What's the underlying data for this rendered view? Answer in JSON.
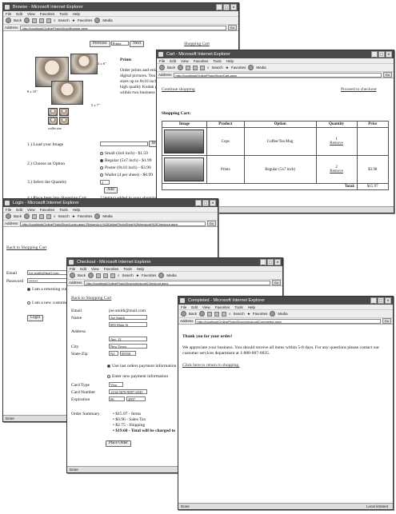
{
  "menu": [
    "File",
    "Edit",
    "View",
    "Favorites",
    "Tools",
    "Help"
  ],
  "toolbar": {
    "back": "Back",
    "search": "Search",
    "favorites": "Favorites",
    "media": "Media",
    "address_label": "Address",
    "go": "Go",
    "links": "Links"
  },
  "status": {
    "done": "Done",
    "zone": "Local intranet"
  },
  "browse": {
    "title": "Browse - Microsoft Internet Explorer",
    "address": "http://localhost/OnlinePhotoShop/Browse.aspx",
    "nav": {
      "previous": "Previous",
      "select_value": "Prints",
      "next": "Next",
      "shopping_cart": "Shopping Cart"
    },
    "sizes": {
      "s4x6": "4 x 6\"",
      "s8x10": "8 x 10\"",
      "s5x7": "5 x 7\"",
      "wallet": "wallet size"
    },
    "prints_title": "Prints",
    "desc": [
      "Order prints and enlarge",
      "digital pictures. You ca",
      "sizes up to 8x10 inch",
      "high quality Kodak pho",
      "within two business da"
    ],
    "steps": {
      "s1": "1.) Load your Image",
      "browse_btn": "Browse",
      "s2": "2.) Choose an Option",
      "s3": "3.) Select the Quantity",
      "qty": "2",
      "add_btn": "Add",
      "s4": "4.) Place Item into Shopping Cart",
      "added": "2 item(s) added to your shopping"
    },
    "options": [
      "Small (4x6 inch) - $1.59",
      "Regular (5x7 inch) - $1.99",
      "Poster (8x10 inch) - $3.99",
      "Wallet (4 per sheet) - $0.99"
    ]
  },
  "cart": {
    "title": "Cart - Microsoft Internet Explorer",
    "address": "http://localhost/OnlinePhotoShop/Cart.aspx",
    "continue": "Continue shopping",
    "checkout": "Proceed to checkout",
    "heading": "Shopping Cart:",
    "headers": [
      "Image",
      "Product",
      "Option",
      "Quantity",
      "Price"
    ],
    "rows": [
      {
        "product": "Cups",
        "option": "Coffee/Tea Mug",
        "qty": "1",
        "remove": "Remove",
        "price": ""
      },
      {
        "product": "Prints",
        "option": "Regular (5x7 inch)",
        "qty": "2",
        "remove": "Remove",
        "price": "$3.98"
      }
    ],
    "total_label": "Total:",
    "total": "$15.97"
  },
  "login": {
    "title": "Login - Microsoft Internet Explorer",
    "address": "http://localhost/OnlinePhotoShop/Login.aspx?ReturnUrl=%2fOnlinePhotoShop%2fcheckout%2fCheckout.aspx",
    "back": "Back to Shopping Cart",
    "email_label": "Email",
    "email": "joe.smith@mail.com",
    "password_label": "Password",
    "password": "•••••••",
    "returning": "I am a returning cust",
    "new": "I am a new customer",
    "login_btn": "Login"
  },
  "checkout": {
    "title": "Checkout - Microsoft Internet Explorer",
    "address": "http://localhost/OnlinePhotoShop/checkout/Checkout.aspx",
    "back": "Back to Shopping Cart",
    "labels": {
      "email": "Email",
      "name": "Name",
      "address": "Address",
      "city": "City",
      "state": "State-Zip",
      "card_type": "Card Type",
      "card_number": "Card Number",
      "expiration": "Expiration",
      "summary": "Order Summary"
    },
    "email": "joe.smith@mail.com",
    "name": "Joe Smith",
    "address1": "800 Main St",
    "address2": "Apt. 12",
    "city": "New Town",
    "state": "NJ",
    "zip": "09550",
    "last_payment": "Use last orders payment information",
    "new_payment": "Enter new payment information",
    "card_type": "Visa",
    "card_number": "1234-5678-9087-6543",
    "exp_month": "06",
    "exp_year": "2007",
    "summary": [
      "$15.97 - Items",
      "$0.96 - Sales Tax",
      "$2.75 - Shipping",
      "$19.68 - Total will be charged to"
    ],
    "place_order": "Place Order"
  },
  "completed": {
    "title": "Completed - Microsoft Internet Explorer",
    "address": "http://localhost/OnlinePhotoShop/checkout/Completed.aspx",
    "thanks": "Thank you for your order!",
    "body": "We appreciate your business. You should receive all items within 5-8 days. For any questions please contact our customer services department at 1-888-007-0035.",
    "return": "Click here to return to shopping."
  }
}
